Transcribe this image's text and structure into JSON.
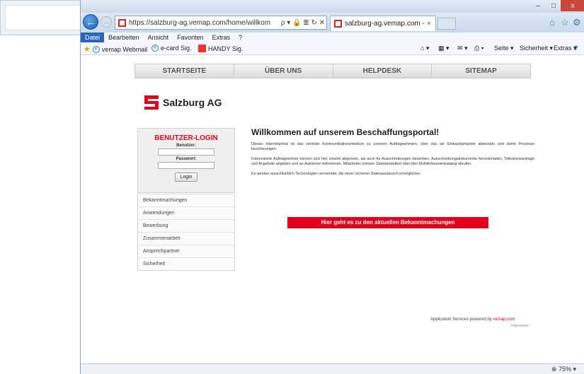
{
  "browser": {
    "address": {
      "url": "https://salzburg-ag.vemap.com/home/willkom",
      "controls": "ρ ▾ 🔒 ≣ ↻ ✕"
    },
    "tab": {
      "title": "salzburg-ag.vemap.com - S...",
      "close": "×"
    },
    "window_controls": {
      "minimize": "–",
      "maximize": "□",
      "close": "x"
    },
    "menu": [
      "Datei",
      "Bearbeiten",
      "Ansicht",
      "Favoriten",
      "Extras",
      "?"
    ],
    "favorites": [
      {
        "label": "vemap Webmail"
      },
      {
        "label": "e-card Sig."
      },
      {
        "label": "HANDY Sig."
      }
    ],
    "command_bar": {
      "page": "Seite ▾",
      "security": "Sicherheit ▾",
      "extras": "Extras ▾",
      "help": "?"
    },
    "zoom": "75%"
  },
  "site": {
    "nav": [
      "STARTSEITE",
      "ÜBER UNS",
      "HELPDESK",
      "SITEMAP"
    ],
    "logo_text": "Salzburg AG",
    "login": {
      "title": "BENUTZER-LOGIN",
      "user_label": "Benutzer:",
      "password_label": "Passwort:",
      "button": "Login"
    },
    "side_menu": [
      "Bekanntmachungen",
      "Anwendungen",
      "Bewerbung",
      "Zusammenarbeit",
      "Ansprechpartner",
      "Sicherheit"
    ],
    "heading": "Willkommen auf unserem Beschaffungsportal!",
    "paragraphs": [
      "Dieses Internetportal ist das zentrale Kommunikationsmedium zu unseren Auftragnehmern, über das wir Einkaufsprojekte abwickeln und damit Prozesse beschleunigen.",
      "Interessierte Auftragnehmer können sich hier sowohl allgemein, als auch für Ausschreibungen bewerben. Ausschreibungsdokumente herunterladen, Teilnahmeanträge und Angebote abgeben und an Auktionen teilnehmen. Mitarbeiter können Standardartikel über den Multilieferantenkatalog abrufen.",
      "Es werden ausschließlich Technologien verwendet, die einen sicheren Datenaustausch ermöglichen."
    ],
    "cta": "Hier geht es zu den aktuellen Bekanntmachungen",
    "powered_prefix": "Application Services powered by",
    "powered_link": "vemap.com",
    "impressum": "Impressum"
  },
  "colors": {
    "brand_red": "#e2001a",
    "ie_blue": "#2a66b5"
  }
}
